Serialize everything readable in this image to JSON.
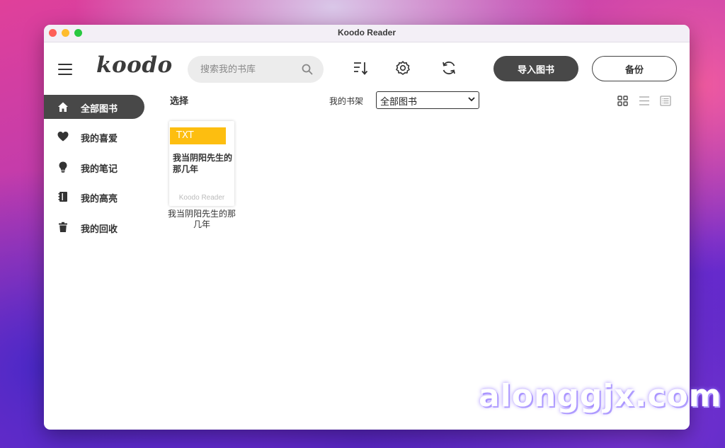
{
  "window": {
    "title": "Koodo Reader"
  },
  "header": {
    "logo": "koodo",
    "search_placeholder": "搜索我的书库",
    "import_label": "导入图书",
    "backup_label": "备份",
    "icons": [
      "menu-icon",
      "sort-icon",
      "settings-icon",
      "sync-icon",
      "search-icon"
    ]
  },
  "sidebar": {
    "items": [
      {
        "label": "全部图书",
        "icon": "home-icon",
        "active": true
      },
      {
        "label": "我的喜爱",
        "icon": "heart-icon",
        "active": false
      },
      {
        "label": "我的笔记",
        "icon": "bulb-icon",
        "active": false
      },
      {
        "label": "我的高亮",
        "icon": "notebook-icon",
        "active": false
      },
      {
        "label": "我的回收",
        "icon": "trash-icon",
        "active": false
      }
    ]
  },
  "toolbar": {
    "select_label": "选择",
    "shelf_label": "我的书架",
    "shelf_selected": "全部图书",
    "view_modes": [
      "grid-view-icon",
      "list-view-icon",
      "card-view-icon"
    ]
  },
  "books": [
    {
      "format": "TXT",
      "cover_title": "我当阴阳先生的那几年",
      "cover_brand": "Koodo Reader",
      "title": "我当阴阳先生的那几年"
    }
  ],
  "watermark": "alonggjx.com",
  "colors": {
    "accent": "#484848",
    "badge": "#fdbe10"
  }
}
